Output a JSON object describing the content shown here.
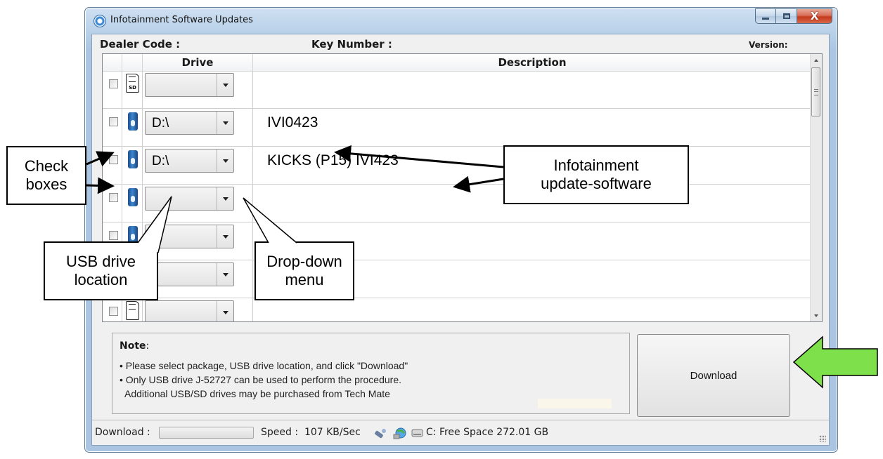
{
  "window": {
    "title": "Infotainment Software Updates",
    "minimize_icon": "minimize-icon",
    "maximize_icon": "maximize-icon",
    "close_glyph": "X"
  },
  "header": {
    "dealer_code_label": "Dealer Code :",
    "key_number_label": "Key Number :",
    "version_label": "Version:"
  },
  "grid": {
    "columns": [
      "",
      "",
      "Drive",
      "Description"
    ],
    "rows": [
      {
        "icon": "sd-card-icon",
        "icon_label": "SD",
        "drive": "",
        "description": ""
      },
      {
        "icon": "usb-drive-icon",
        "drive": "D:\\",
        "description": "IVI0423"
      },
      {
        "icon": "usb-drive-icon",
        "drive": "D:\\",
        "description": "KICKS (P15) IVI423"
      },
      {
        "icon": "usb-drive-icon",
        "drive": "",
        "description": ""
      },
      {
        "icon": "usb-drive-icon",
        "drive": "",
        "description": ""
      },
      {
        "icon": "usb-drive-icon",
        "drive": "",
        "description": ""
      },
      {
        "icon": "sd-card-icon",
        "drive": "",
        "description": ""
      }
    ]
  },
  "note": {
    "title": "Note",
    "title_suffix": ":",
    "lines": [
      "• Please select package, USB drive location, and click \"Download\"",
      "• Only USB drive J-52727 can be used to perform the procedure.",
      "  Additional USB/SD drives may be purchased from Tech Mate"
    ]
  },
  "download_button": "Download",
  "status": {
    "download_label": "Download :",
    "progress": 0,
    "speed": "Speed :  107 KB/Sec",
    "free_space": "C: Free Space 272.01 GB"
  },
  "annotations": {
    "check_boxes": [
      "Check",
      "boxes"
    ],
    "infotainment": [
      "Infotainment",
      "update-software"
    ],
    "usb_drive_location": [
      "USB drive",
      "location"
    ],
    "drop_down_menu": [
      "Drop-down",
      "menu"
    ]
  },
  "colors": {
    "accent_arrow": "#7ee04a",
    "window_frame": "#a9c5e2",
    "close_button": "#c5391c"
  }
}
